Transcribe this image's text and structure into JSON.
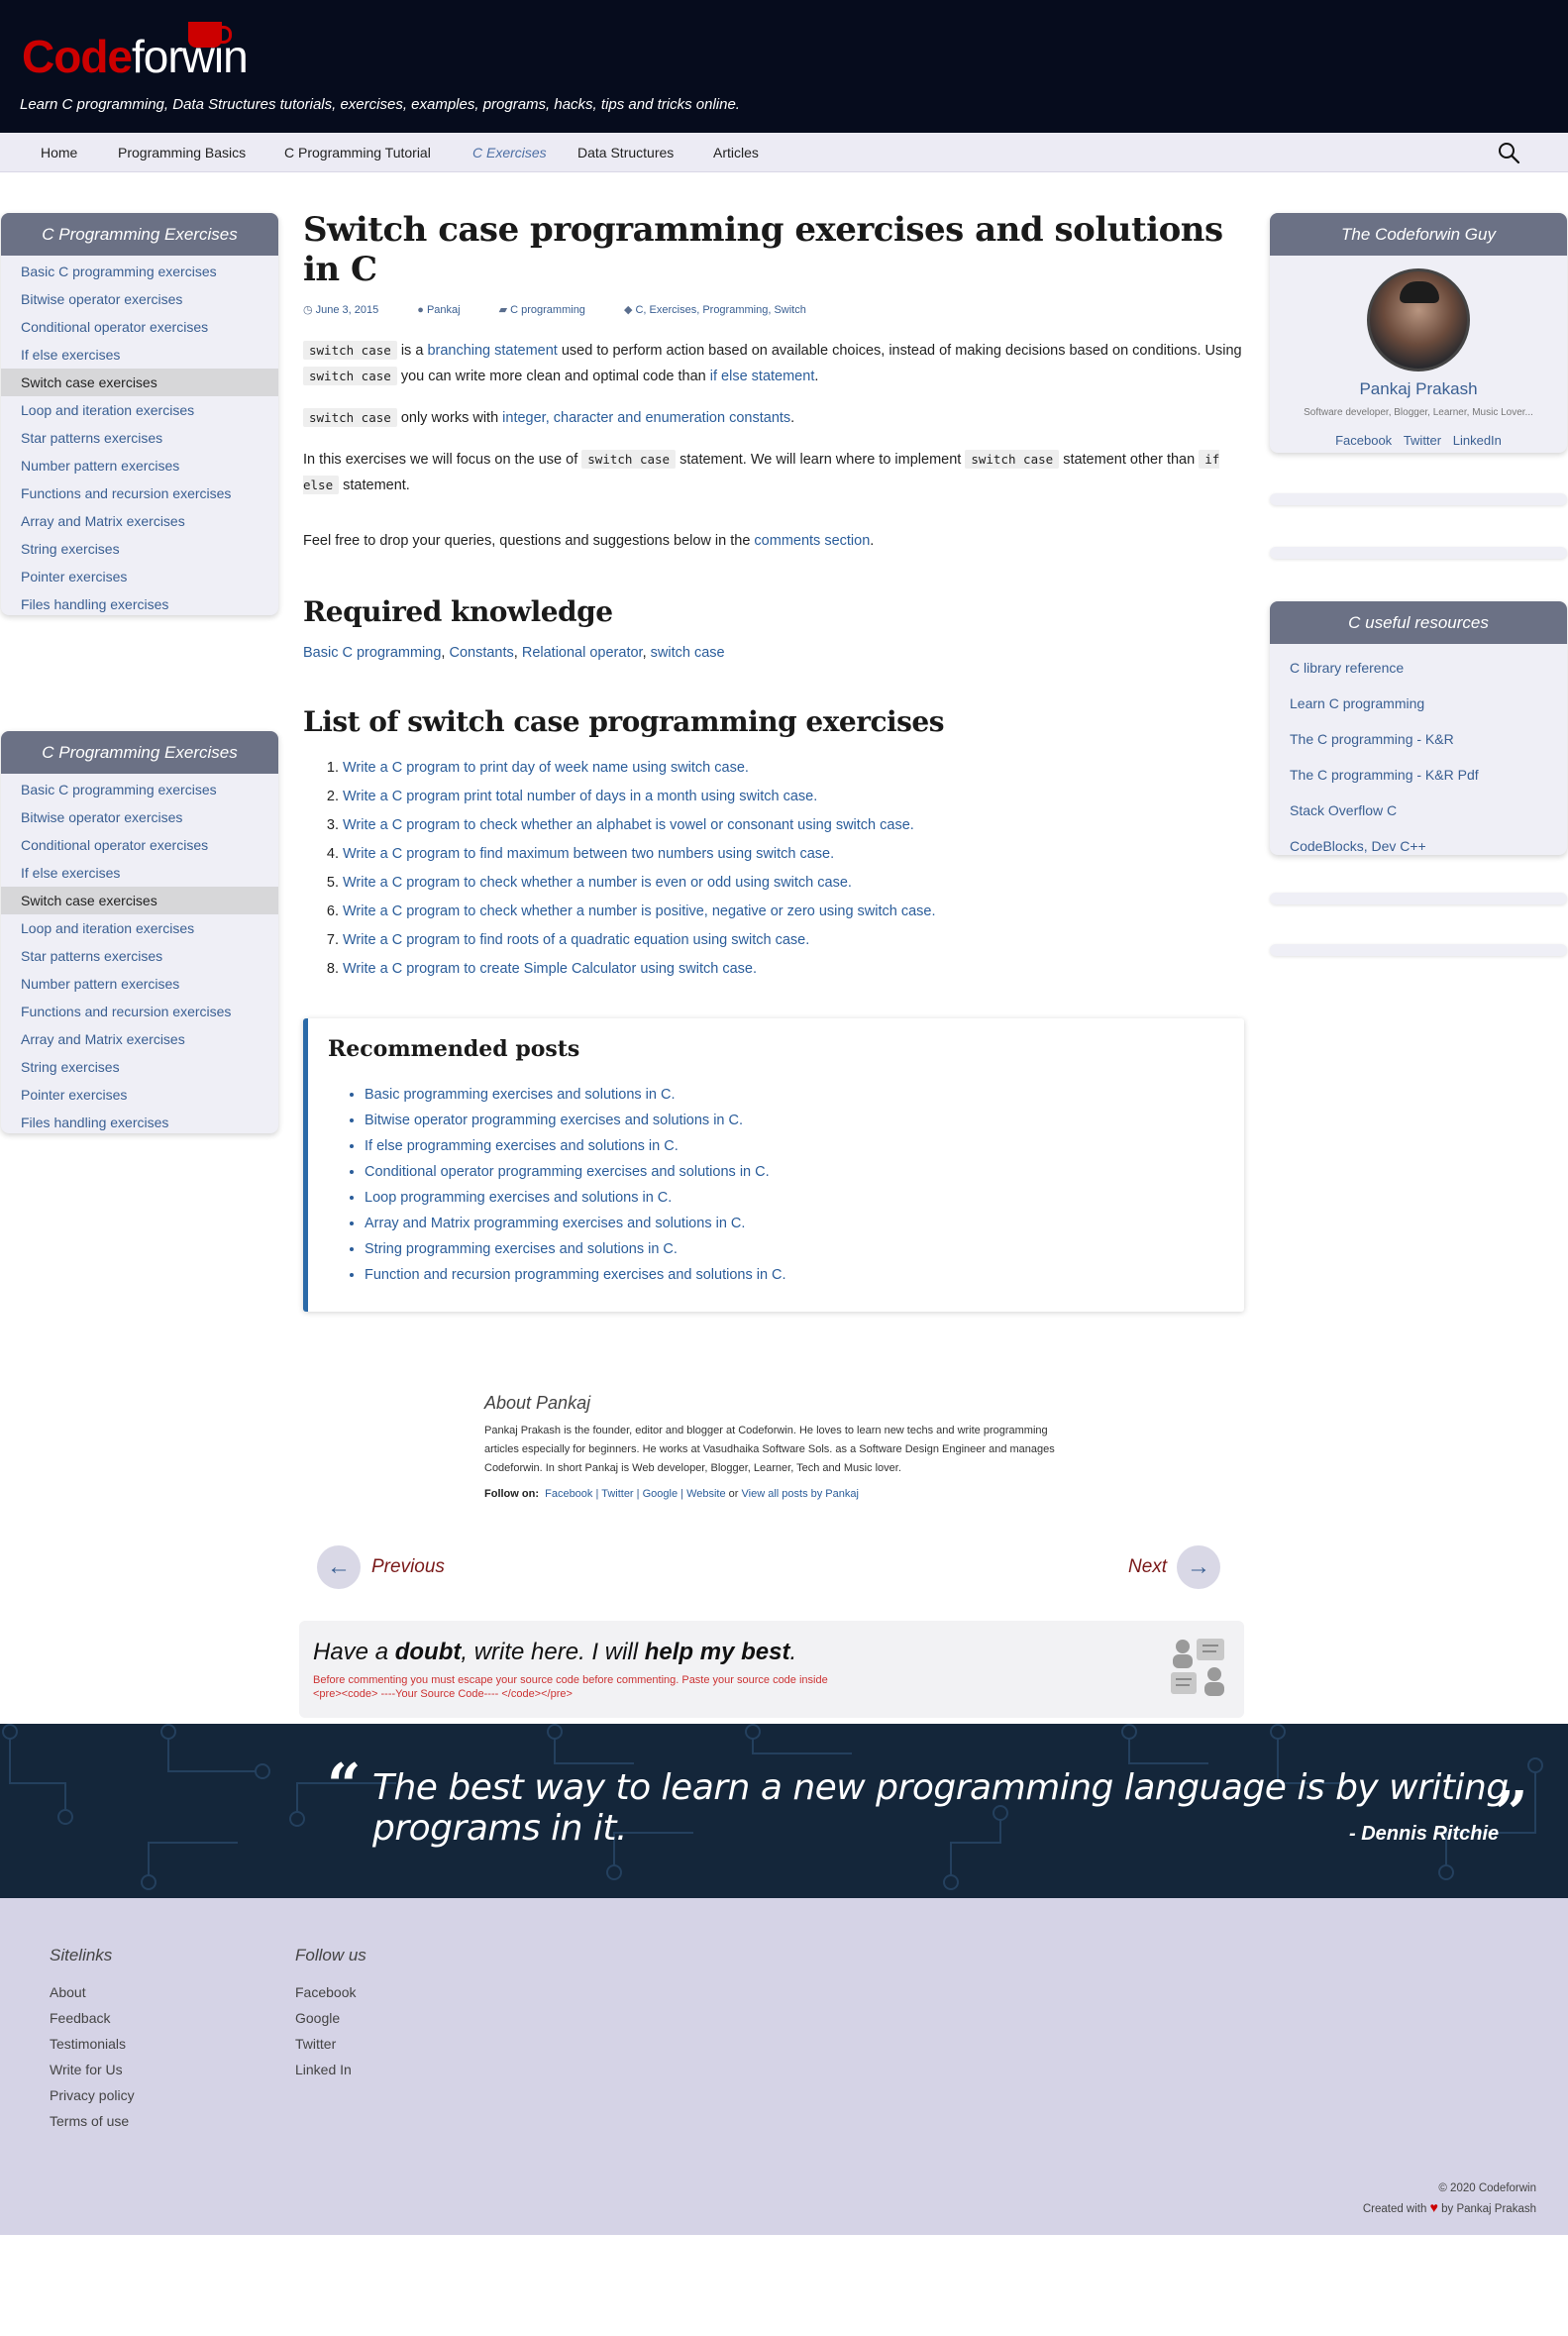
{
  "header": {
    "logo_code": "Code",
    "logo_forwin": "forwin",
    "tagline": "Learn C programming, Data Structures tutorials, exercises, examples, programs, hacks, tips and tricks online."
  },
  "nav": {
    "items": [
      "Home",
      "Programming Basics",
      "C Programming Tutorial",
      "C Exercises",
      "Data Structures",
      "Articles"
    ],
    "active": "C Exercises"
  },
  "sidebar": {
    "title": "C Programming Exercises",
    "items": [
      "Basic C programming exercises",
      "Bitwise operator exercises",
      "Conditional operator exercises",
      "If else exercises",
      "Switch case exercises",
      "Loop and iteration exercises",
      "Star patterns exercises",
      "Number pattern exercises",
      "Functions and recursion exercises",
      "Array and Matrix exercises",
      "String exercises",
      "Pointer exercises",
      "Files handling exercises"
    ],
    "selected": "Switch case exercises"
  },
  "article": {
    "title": "Switch case programming exercises and solutions in C",
    "meta": {
      "date": "June 3, 2015",
      "author": "Pankaj",
      "category": "C programming",
      "tags": "C, Exercises, Programming, Switch"
    },
    "p1": {
      "code1": "switch case",
      "t1": "is a",
      "link1": "branching statement",
      "t2": "used to perform action based on available choices, instead of making decisions based on conditions. Using",
      "code2": "switch case",
      "t3": "you can write more clean and optimal code than",
      "link2": "if else statement",
      "t4": "."
    },
    "p2": {
      "code": "switch case",
      "t1": "only works with",
      "link": "integer, character and enumeration constants",
      "t2": "."
    },
    "p3": {
      "t1": "In this exercises we will focus on the use of",
      "code1": "switch case",
      "t2": "statement. We will learn where to implement",
      "code2": "switch case",
      "t3": "statement other than",
      "code3": "if else",
      "t4": "statement."
    },
    "p4": {
      "t1": "Feel free to drop your queries, questions and suggestions below in the",
      "link": "comments section",
      "t2": "."
    },
    "required_heading": "Required knowledge",
    "required_links": [
      "Basic C programming",
      "Constants",
      "Relational operator",
      "switch case"
    ],
    "list_heading": "List of switch case programming exercises",
    "exercises": [
      "Write a C program to print day of week name using switch case.",
      "Write a C program print total number of days in a month using switch case.",
      "Write a C program to check whether an alphabet is vowel or consonant using switch case.",
      "Write a C program to find maximum between two numbers using switch case.",
      "Write a C program to check whether a number is even or odd using switch case.",
      "Write a C program to check whether a number is positive, negative or zero using switch case.",
      "Write a C program to find roots of a quadratic equation using switch case.",
      "Write a C program to create Simple Calculator using switch case."
    ]
  },
  "recommended": {
    "title": "Recommended posts",
    "items": [
      "Basic programming exercises and solutions in C.",
      "Bitwise operator programming exercises and solutions in C.",
      "If else programming exercises and solutions in C.",
      "Conditional operator programming exercises and solutions in C.",
      "Loop programming exercises and solutions in C.",
      "Array and Matrix programming exercises and solutions in C.",
      "String programming exercises and solutions in C.",
      "Function and recursion programming exercises and solutions in C."
    ]
  },
  "about": {
    "heading": "About Pankaj",
    "bio": "Pankaj Prakash is the founder, editor and blogger at Codeforwin. He loves to learn new techs and write programming articles especially for beginners. He works at Vasudhaika Software Sols. as a Software Design Engineer and manages Codeforwin. In short Pankaj is Web developer, Blogger, Learner, Tech and Music lover.",
    "follow_label": "Follow on:",
    "links": [
      "Facebook",
      "Twitter",
      "Google",
      "Website"
    ],
    "or": "or",
    "all_posts": "View all posts by Pankaj"
  },
  "pagination": {
    "prev": "Previous",
    "next": "Next",
    "prev_arrow": "←",
    "next_arrow": "→"
  },
  "comment_box": {
    "t1": "Have a",
    "b1": "doubt",
    "t2": ", write here. I will",
    "b2": "help my best",
    "t3": ".",
    "line1": "Before commenting you must escape your source code before commenting. Paste your source code inside",
    "line2": "<pre><code> ----Your Source Code---- </code></pre>"
  },
  "right": {
    "guy_title": "The Codeforwin Guy",
    "guy_name": "Pankaj Prakash",
    "guy_desc": "Software developer, Blogger, Learner, Music Lover...",
    "guy_links": [
      "Facebook",
      "Twitter",
      "LinkedIn"
    ],
    "resources_title": "C useful resources",
    "resources": [
      "C library reference",
      "Learn C programming",
      "The C programming - K&R",
      "The C programming - K&R Pdf",
      "Stack Overflow C",
      "CodeBlocks, Dev C++"
    ]
  },
  "quote": {
    "text": "The best way to learn a new programming language is by writing programs in it.",
    "author": "- Dennis Ritchie"
  },
  "footer": {
    "sitelinks_title": "Sitelinks",
    "sitelinks": [
      "About",
      "Feedback",
      "Testimonials",
      "Write for Us",
      "Privacy policy",
      "Terms of use"
    ],
    "follow_title": "Follow us",
    "follow": [
      "Facebook",
      "Google",
      "Twitter",
      "Linked In"
    ],
    "copyright": "© 2020 Codeforwin",
    "created_a": "Created with",
    "created_b": "by Pankaj Prakash"
  },
  "colors": {
    "header_bg": "#060c1d",
    "brand_red": "#cc0000",
    "link": "#2b5d9a",
    "box_header": "#6b7185",
    "quote_bg": "#14263a",
    "footer_bg": "#d5d3e6"
  }
}
